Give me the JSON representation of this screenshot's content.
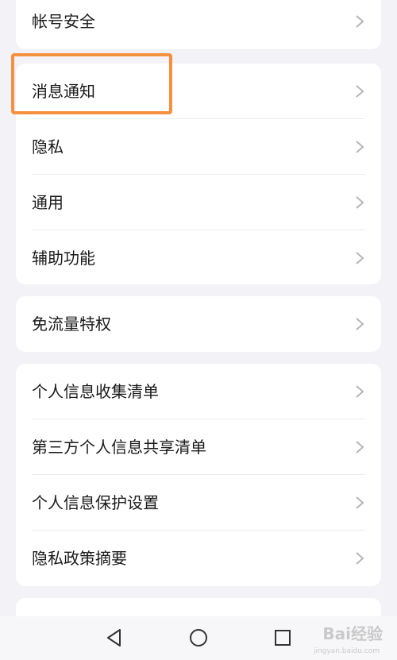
{
  "groups": [
    {
      "items": [
        {
          "label": "帐号安全"
        }
      ]
    },
    {
      "items": [
        {
          "label": "消息通知"
        },
        {
          "label": "隐私"
        },
        {
          "label": "通用"
        },
        {
          "label": "辅助功能"
        }
      ]
    },
    {
      "items": [
        {
          "label": "免流量特权"
        }
      ]
    },
    {
      "items": [
        {
          "label": "个人信息收集清单"
        },
        {
          "label": "第三方个人信息共享清单"
        },
        {
          "label": "个人信息保护设置"
        },
        {
          "label": "隐私政策摘要"
        }
      ]
    }
  ],
  "icons": {
    "chevron": "chevron-right-icon",
    "nav_back": "triangle-back-icon",
    "nav_home": "circle-home-icon",
    "nav_recent": "square-recent-icon"
  },
  "colors": {
    "background": "#f2f2f7",
    "card": "#ffffff",
    "highlight": "#f5913e",
    "chevron": "#b5b5b5"
  },
  "watermark": {
    "text": "Bai经验",
    "sub": "jingyan.baidu.com"
  }
}
